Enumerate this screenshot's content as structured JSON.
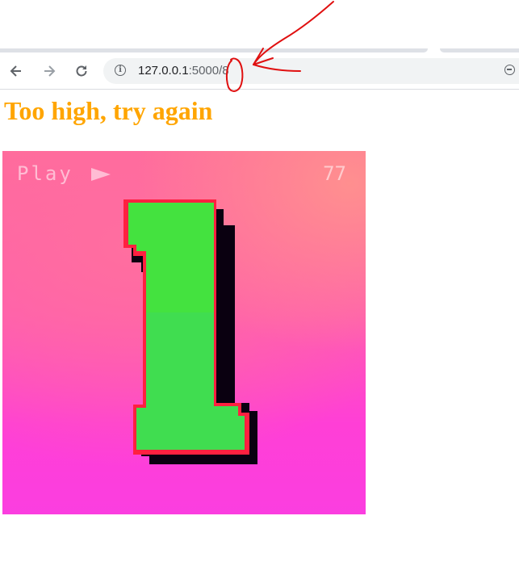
{
  "browser": {
    "url_host": "127.0.0.1",
    "url_path": ":5000/8"
  },
  "page": {
    "heading": "Too high, try again",
    "heading_color": "#ffa500"
  },
  "gif": {
    "play_label": "Play",
    "counter": "77",
    "digit_shown": "1",
    "digit_color": "#44e23f"
  },
  "annotation": {
    "color": "#e01010"
  }
}
